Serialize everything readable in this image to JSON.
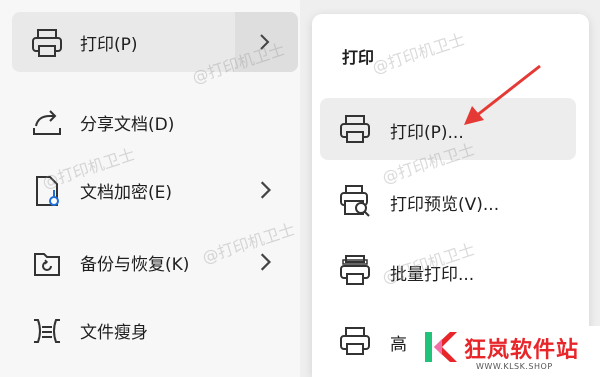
{
  "left_menu": {
    "items": [
      {
        "label": "打印(P)"
      },
      {
        "label": "分享文档(D)"
      },
      {
        "label": "文档加密(E)"
      },
      {
        "label": "备份与恢复(K)"
      },
      {
        "label": "文件瘦身"
      }
    ]
  },
  "submenu": {
    "title": "打印",
    "items": [
      {
        "label": "打印(P)..."
      },
      {
        "label": "打印预览(V)..."
      },
      {
        "label": "批量打印..."
      },
      {
        "label": "高"
      }
    ]
  },
  "watermark": "@打印机卫士",
  "logo": {
    "text": "狂岚软件站",
    "url": "WWW.KLSK.SHOP",
    "accent": "#e8262a"
  },
  "colors": {
    "arrow": "#e53935",
    "hover": "#e9e9e9"
  }
}
